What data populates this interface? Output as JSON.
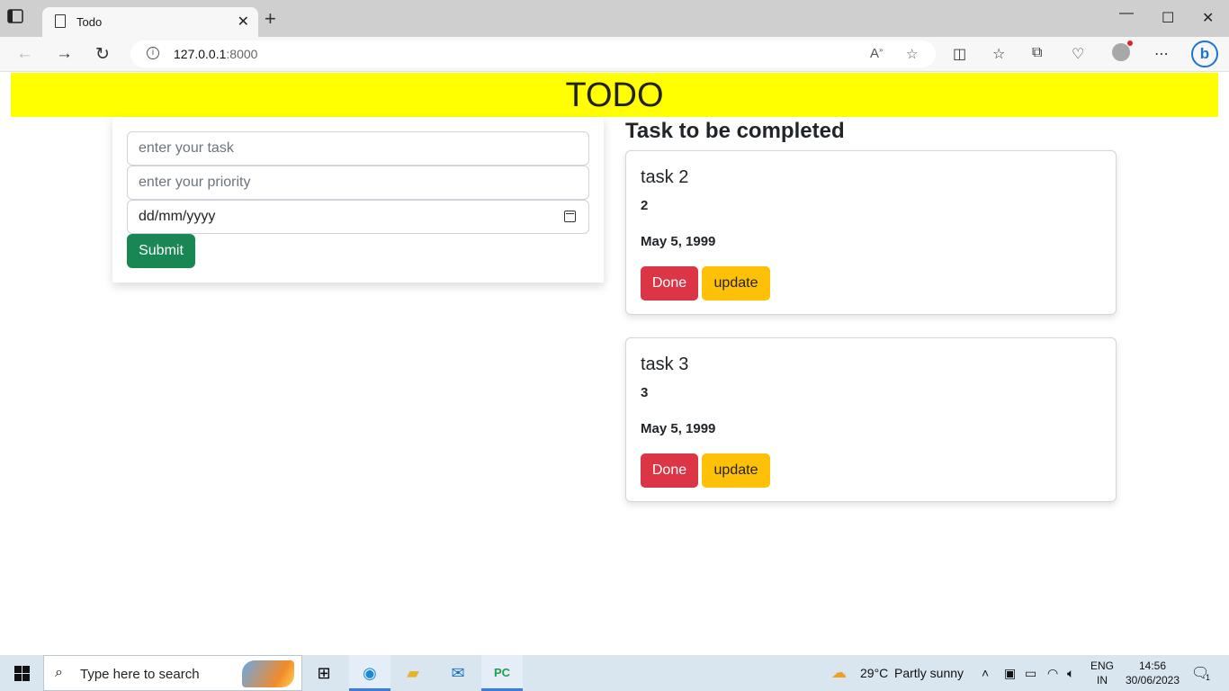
{
  "browser": {
    "tab_title": "Todo",
    "url_host": "127.0.0.1",
    "url_port": ":8000",
    "new_tab": "+",
    "close_tab": "✕"
  },
  "page": {
    "header": "TODO",
    "form": {
      "task_placeholder": "enter your task",
      "priority_placeholder": "enter your priority",
      "date_placeholder": "dd/mm/yyyy",
      "submit_label": "Submit"
    },
    "list_title": "Task to be completed",
    "tasks": [
      {
        "name": "task 2",
        "priority": "2",
        "date": "May 5, 1999",
        "done_label": "Done",
        "update_label": "update"
      },
      {
        "name": "task 3",
        "priority": "3",
        "date": "May 5, 1999",
        "done_label": "Done",
        "update_label": "update"
      }
    ]
  },
  "taskbar": {
    "search_placeholder": "Type here to search",
    "weather_temp": "29°C",
    "weather_text": "Partly sunny",
    "lang_top": "ENG",
    "lang_bottom": "IN",
    "time": "14:56",
    "date": "30/06/2023",
    "notification_count": "1"
  },
  "colors": {
    "header_bg": "#ffff00",
    "submit": "#198754",
    "done": "#dc3545",
    "update": "#ffc107"
  }
}
